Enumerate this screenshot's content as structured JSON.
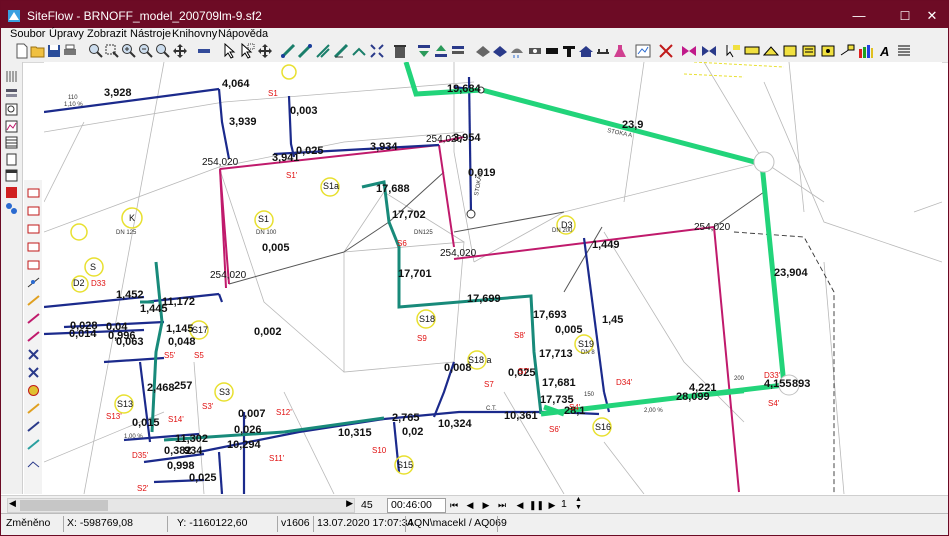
{
  "window": {
    "title": "SiteFlow - BRNOFF_model_200709lm-9.sf2",
    "minimize_glyph": "—",
    "maximize_glyph": "☐",
    "close_glyph": "✕"
  },
  "menu": [
    "Soubor",
    "Úpravy",
    "Zobrazit",
    "Nástroje",
    "Knihovny",
    "Nápověda"
  ],
  "drawing": {
    "pipe_labels": [
      {
        "t": "3,928"
      },
      {
        "t": "4,064"
      },
      {
        "t": "3,939"
      },
      {
        "t": "0,003"
      },
      {
        "t": "3,941"
      },
      {
        "t": "0,025"
      },
      {
        "t": "3,934"
      },
      {
        "t": "3,954"
      },
      {
        "t": "19,684"
      },
      {
        "t": "23,9"
      },
      {
        "t": "0,019"
      },
      {
        "t": "17,688"
      },
      {
        "t": "17,702"
      },
      {
        "t": "0,005"
      },
      {
        "t": "17,701"
      },
      {
        "t": "1,449"
      },
      {
        "t": "23,904"
      },
      {
        "t": "1,452"
      },
      {
        "t": "11,172"
      },
      {
        "t": "17,699"
      },
      {
        "t": "17,693"
      },
      {
        "t": "0,005"
      },
      {
        "t": "1,45"
      },
      {
        "t": "0,028"
      },
      {
        "t": "0,04"
      },
      {
        "t": "1,445"
      },
      {
        "t": "0,014"
      },
      {
        "t": "0,996"
      },
      {
        "t": "0,063"
      },
      {
        "t": "1,145"
      },
      {
        "t": "0,048"
      },
      {
        "t": "0,002"
      },
      {
        "t": "17,713"
      },
      {
        "t": "0,008"
      },
      {
        "t": "0,025"
      },
      {
        "t": "17,681"
      },
      {
        "t": "2,468"
      },
      {
        "t": "257"
      },
      {
        "t": "4,221"
      },
      {
        "t": "4,155"
      },
      {
        "t": "893"
      },
      {
        "t": "28,099"
      },
      {
        "t": "17,735"
      },
      {
        "t": "28,1"
      },
      {
        "t": "0,015"
      },
      {
        "t": "0,007"
      },
      {
        "t": "2,765"
      },
      {
        "t": "10,361"
      },
      {
        "t": "11,302"
      },
      {
        "t": "0,026"
      },
      {
        "t": "10,315"
      },
      {
        "t": "0,02"
      },
      {
        "t": "10,324"
      },
      {
        "t": "0,382"
      },
      {
        "t": "10,294"
      },
      {
        "t": "934"
      },
      {
        "t": "0,998"
      },
      {
        "t": "0,025"
      }
    ],
    "node_labels": [
      {
        "t": "254,020"
      },
      {
        "t": "254,020"
      },
      {
        "t": "254,020"
      },
      {
        "t": "254,020"
      },
      {
        "t": "254,020"
      }
    ],
    "circle_labels": [
      {
        "t": "S1a"
      },
      {
        "t": "S1"
      },
      {
        "t": "K"
      },
      {
        "t": "S"
      },
      {
        "t": "D2"
      },
      {
        "t": "D3"
      },
      {
        "t": "S17"
      },
      {
        "t": "S18"
      },
      {
        "t": "S18 a"
      },
      {
        "t": "S19"
      },
      {
        "t": "S3"
      },
      {
        "t": "S13"
      },
      {
        "t": "S16"
      },
      {
        "t": "S15"
      }
    ],
    "red_labels": [
      {
        "t": "S1"
      },
      {
        "t": "S1'"
      },
      {
        "t": "S6"
      },
      {
        "t": "S9"
      },
      {
        "t": "S8'"
      },
      {
        "t": "S7'"
      },
      {
        "t": "S7"
      },
      {
        "t": "S6'"
      },
      {
        "t": "S4'"
      },
      {
        "t": "D34'"
      },
      {
        "t": "D33'"
      },
      {
        "t": "S4'"
      },
      {
        "t": "S5"
      },
      {
        "t": "S5'"
      },
      {
        "t": "S13'"
      },
      {
        "t": "S14'"
      },
      {
        "t": "S12'"
      },
      {
        "t": "S11'"
      },
      {
        "t": "S10"
      },
      {
        "t": "D35'"
      },
      {
        "t": "S2'"
      },
      {
        "t": "S3'"
      },
      {
        "t": "D33"
      }
    ],
    "small_labels": [
      {
        "t": "DN 100"
      },
      {
        "t": "110"
      },
      {
        "t": "1,10 %"
      },
      {
        "t": "DN125"
      },
      {
        "t": "DN 125"
      },
      {
        "t": "STOKA B"
      },
      {
        "t": "STOKA A"
      },
      {
        "t": "DN 200"
      },
      {
        "t": "200"
      },
      {
        "t": "2,00 %"
      },
      {
        "t": "C.T."
      },
      {
        "t": "DN 8"
      },
      {
        "t": "150"
      },
      {
        "t": "1,00 %"
      }
    ]
  },
  "navbar": {
    "frame": "45",
    "time": "00:46:00",
    "step": "1"
  },
  "status": {
    "state": "Změněno",
    "x": "X: -598769,08",
    "y": "Y: -1160122,60",
    "version": "v1606",
    "datetime": "13.07.2020 17:07:34",
    "user": "AQN\\macekl / AQ069"
  },
  "colors": {
    "titlebar": "#6d0b25",
    "pipe_green": "#22d47a",
    "pipe_teal": "#188a7a",
    "pipe_blue": "#1b2a8c",
    "pipe_magenta": "#c01a6c",
    "label_red": "#e01010",
    "circle_yellow": "#e8e030"
  },
  "icons": [
    "app-icon",
    "new-icon",
    "open-icon",
    "save-icon",
    "print-icon",
    "cut-icon",
    "copy-icon",
    "paste-icon",
    "zoom-icon",
    "zoom-window-icon",
    "zoom-in-icon",
    "zoom-out-icon",
    "pan-icon",
    "select-icon",
    "move-icon",
    "delete-icon",
    "play-icon",
    "stop-icon",
    "pause-icon"
  ]
}
